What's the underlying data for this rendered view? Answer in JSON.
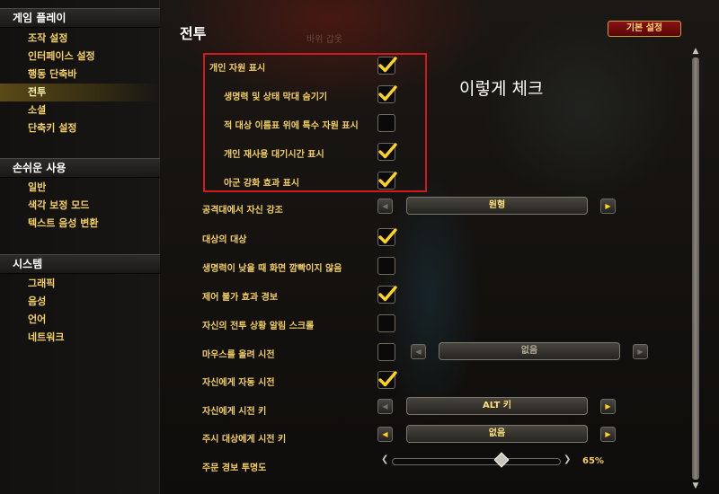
{
  "sidebar": {
    "categories": [
      {
        "title": "게임 플레이",
        "items": [
          "조작 설정",
          "인터페이스 설정",
          "행동 단축바",
          "전투",
          "소셜",
          "단축키 설정"
        ]
      },
      {
        "title": "손쉬운 사용",
        "items": [
          "일반",
          "색각 보정 모드",
          "텍스트 음성 변환"
        ]
      },
      {
        "title": "시스템",
        "items": [
          "그래픽",
          "음성",
          "언어",
          "네트워크"
        ]
      }
    ],
    "active_item": "전투"
  },
  "main": {
    "title": "전투",
    "background_text": "바위 갑옷",
    "defaults_button": "기본 설정",
    "annotation": "이렇게 체크",
    "options": [
      {
        "label": "개인 자원 표시",
        "checked": true
      },
      {
        "label": "생명력 및 상태 막대 숨기기",
        "checked": true
      },
      {
        "label": "적 대상 이름표 위에 특수 자원 표시",
        "checked": false
      },
      {
        "label": "개인 재사용 대기시간 표시",
        "checked": true
      },
      {
        "label": "아군 강화 효과 표시",
        "checked": true
      },
      {
        "label": "공격대에서 자신 강조",
        "dropdown": "원형"
      },
      {
        "label": "대상의 대상",
        "checked": true
      },
      {
        "label": "생명력이 낮을 때 화면 깜빡이지 않음",
        "checked": false
      },
      {
        "label": "제어 불가 효과 경보",
        "checked": true
      },
      {
        "label": "자신의 전투 상황 알림 스크롤",
        "checked": false
      },
      {
        "label": "마우스를 올려 시전",
        "checked": false,
        "dropdown": "없음"
      },
      {
        "label": "자신에게 자동 시전",
        "checked": true
      },
      {
        "label": "자신에게 시전 키",
        "dropdown": "ALT 키"
      },
      {
        "label": "주시 대상에게 시전 키",
        "dropdown": "없음"
      },
      {
        "label": "주문 경보 투명도",
        "slider_value": "65%",
        "slider_fraction": 0.65
      }
    ]
  },
  "colors": {
    "label_gold": "#f2cf63",
    "checkmark_yellow": "#ffd21c",
    "highlight_red": "#d11a20",
    "defaults_button_red": "#7a0e0e"
  },
  "icons": {
    "checkmark": "check-icon",
    "left_arrow": "left-arrow-icon",
    "right_arrow": "right-arrow-icon",
    "scroll_up": "scroll-up-icon",
    "scroll_down": "scroll-down-icon"
  }
}
